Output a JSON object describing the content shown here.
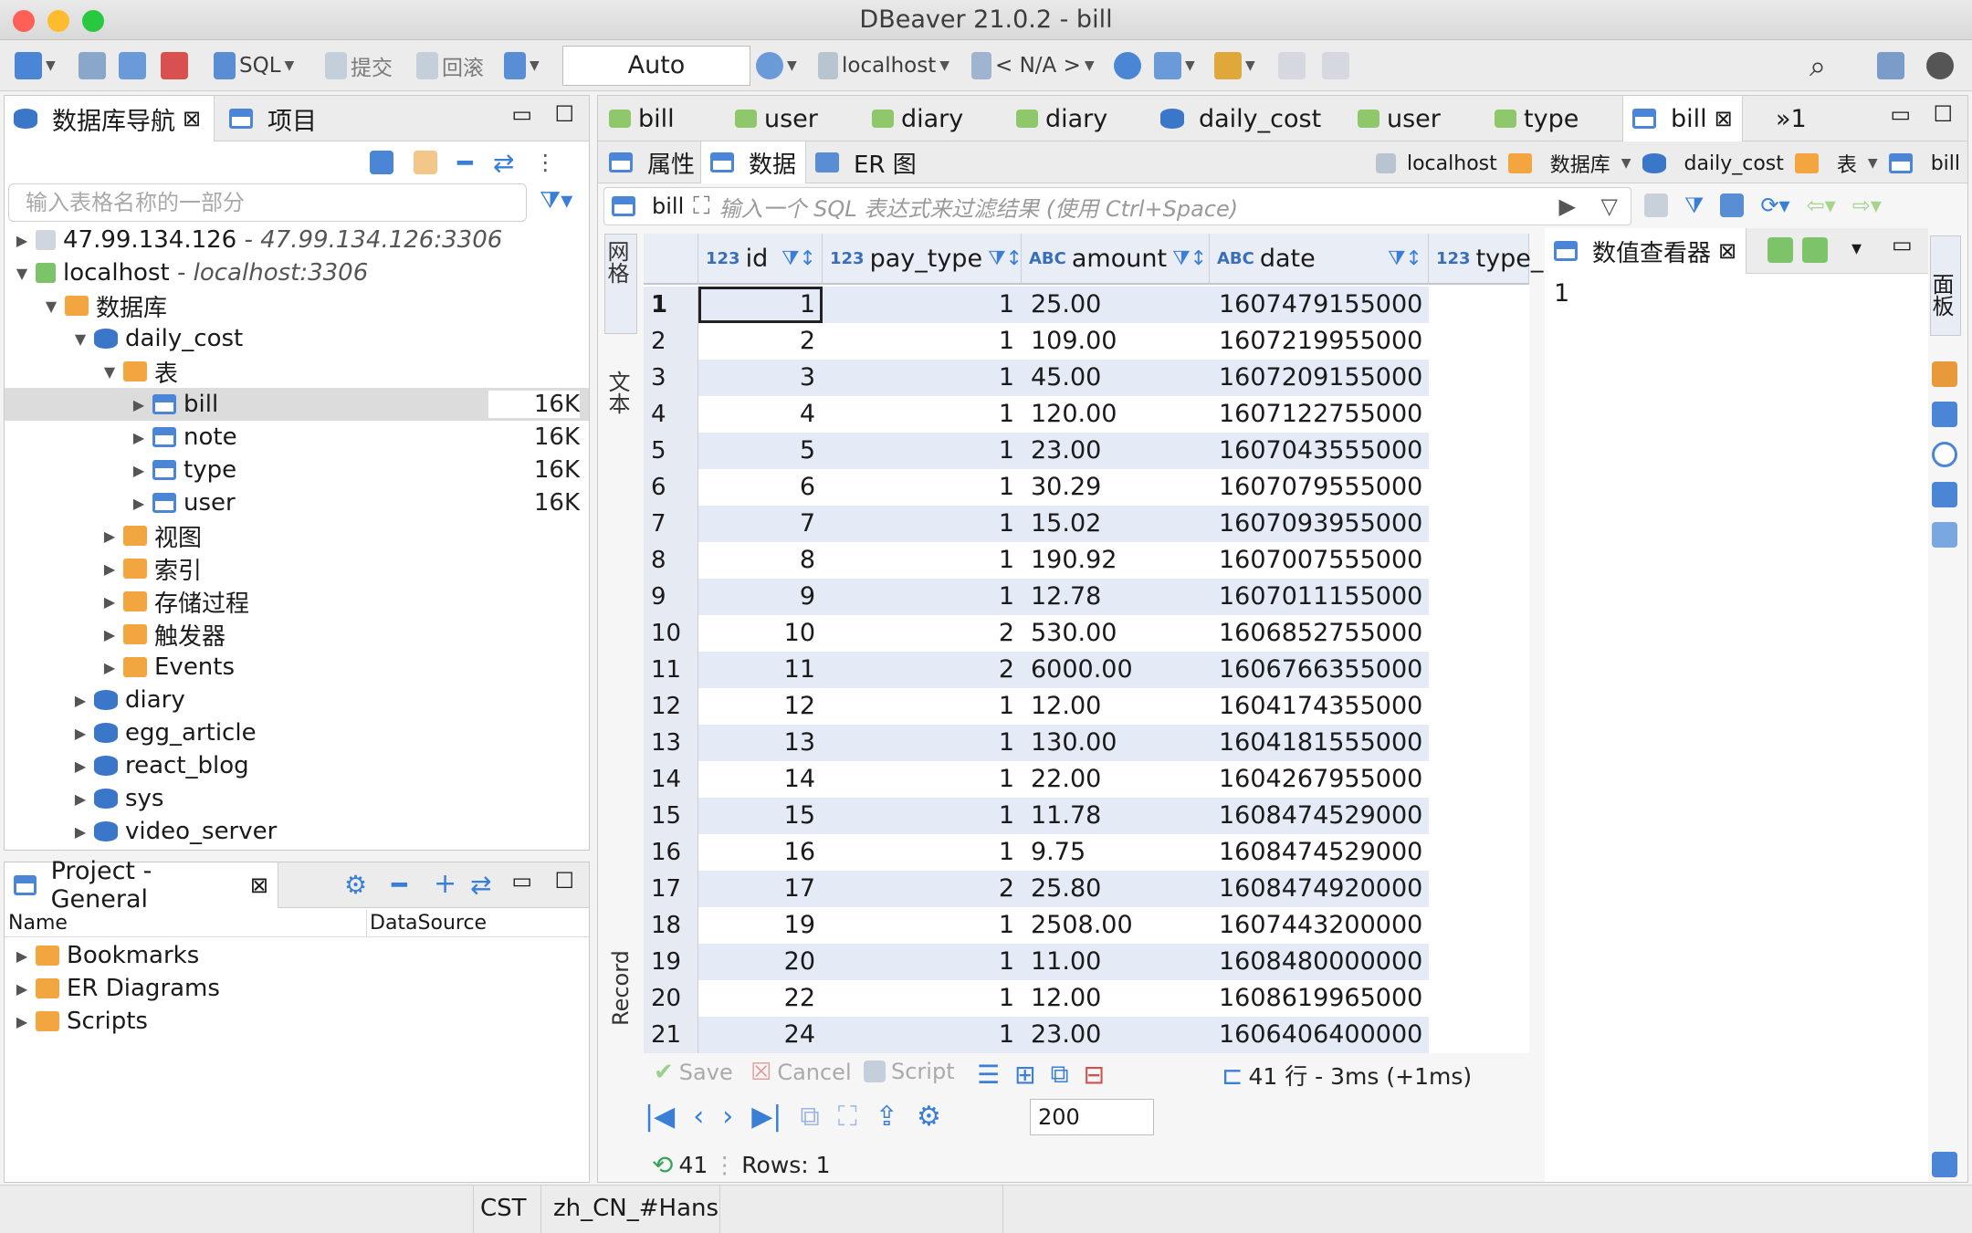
{
  "window": {
    "title": "DBeaver 21.0.2 - bill"
  },
  "toolbar": {
    "sql": "SQL",
    "commit": "提交",
    "rollback": "回滚",
    "auto": "Auto",
    "connection": "localhost",
    "schema": "< N/A >"
  },
  "nav": {
    "tab_db": "数据库导航",
    "tab_project": "项目",
    "filter_placeholder": "输入表格名称的一部分",
    "remote": {
      "name": "47.99.134.126",
      "detail": "- 47.99.134.126:3306"
    },
    "local": {
      "name": "localhost",
      "detail": "- localhost:3306"
    },
    "databases": "数据库",
    "daily_cost": "daily_cost",
    "tables": "表",
    "table_items": [
      {
        "name": "bill",
        "size": "16K"
      },
      {
        "name": "note",
        "size": "16K"
      },
      {
        "name": "type",
        "size": "16K"
      },
      {
        "name": "user",
        "size": "16K"
      }
    ],
    "folders": [
      "视图",
      "索引",
      "存储过程",
      "触发器",
      "Events"
    ],
    "other_dbs": [
      "diary",
      "egg_article",
      "react_blog",
      "sys",
      "video_server"
    ]
  },
  "project": {
    "title": "Project - General",
    "col_name": "Name",
    "col_ds": "DataSource",
    "items": [
      "Bookmarks",
      "ER Diagrams",
      "Scripts"
    ]
  },
  "editor": {
    "tabs": [
      "bill",
      "user",
      "diary",
      "diary",
      "daily_cost",
      "user",
      "type",
      "bill"
    ],
    "more": "»1",
    "subtabs": [
      "属性",
      "数据",
      "ER 图"
    ],
    "crumbs": [
      "localhost",
      "数据库",
      "daily_cost",
      "表",
      "bill"
    ],
    "filter_label": "bill",
    "filter_placeholder": "输入一个 SQL 表达式来过滤结果 (使用 Ctrl+Space)",
    "side_grid": "网格",
    "side_text": "文本",
    "side_record": "Record"
  },
  "grid": {
    "columns": [
      {
        "type": "123",
        "name": "id"
      },
      {
        "type": "123",
        "name": "pay_type"
      },
      {
        "type": "ABC",
        "name": "amount"
      },
      {
        "type": "ABC",
        "name": "date"
      },
      {
        "type": "123",
        "name": "type_"
      }
    ],
    "rows": [
      [
        "1",
        "1",
        "1",
        "25.00",
        "1607479155000"
      ],
      [
        "2",
        "2",
        "1",
        "109.00",
        "1607219955000"
      ],
      [
        "3",
        "3",
        "1",
        "45.00",
        "1607209155000"
      ],
      [
        "4",
        "4",
        "1",
        "120.00",
        "1607122755000"
      ],
      [
        "5",
        "5",
        "1",
        "23.00",
        "1607043555000"
      ],
      [
        "6",
        "6",
        "1",
        "30.29",
        "1607079555000"
      ],
      [
        "7",
        "7",
        "1",
        "15.02",
        "1607093955000"
      ],
      [
        "8",
        "8",
        "1",
        "190.92",
        "1607007555000"
      ],
      [
        "9",
        "9",
        "1",
        "12.78",
        "1607011155000"
      ],
      [
        "10",
        "10",
        "2",
        "530.00",
        "1606852755000"
      ],
      [
        "11",
        "11",
        "2",
        "6000.00",
        "1606766355000"
      ],
      [
        "12",
        "12",
        "1",
        "12.00",
        "1604174355000"
      ],
      [
        "13",
        "13",
        "1",
        "130.00",
        "1604181555000"
      ],
      [
        "14",
        "14",
        "1",
        "22.00",
        "1604267955000"
      ],
      [
        "15",
        "15",
        "1",
        "11.78",
        "1608474529000"
      ],
      [
        "16",
        "16",
        "1",
        "9.75",
        "1608474529000"
      ],
      [
        "17",
        "17",
        "2",
        "25.80",
        "1608474920000"
      ],
      [
        "18",
        "19",
        "1",
        "2508.00",
        "1607443200000"
      ],
      [
        "19",
        "20",
        "1",
        "11.00",
        "1608480000000"
      ],
      [
        "20",
        "22",
        "1",
        "12.00",
        "1608619965000"
      ],
      [
        "21",
        "24",
        "1",
        "23.00",
        "1606406400000"
      ]
    ]
  },
  "viewer": {
    "title": "数值查看器",
    "value": "1",
    "panel_label": "面板"
  },
  "footer": {
    "save": "Save",
    "cancel": "Cancel",
    "script": "Script",
    "rows_info": "41 行 - 3ms (+1ms)",
    "fetch_size": "200",
    "count": "41",
    "rows_sel": "Rows: 1"
  },
  "status": {
    "tz": "CST",
    "locale": "zh_CN_#Hans"
  }
}
